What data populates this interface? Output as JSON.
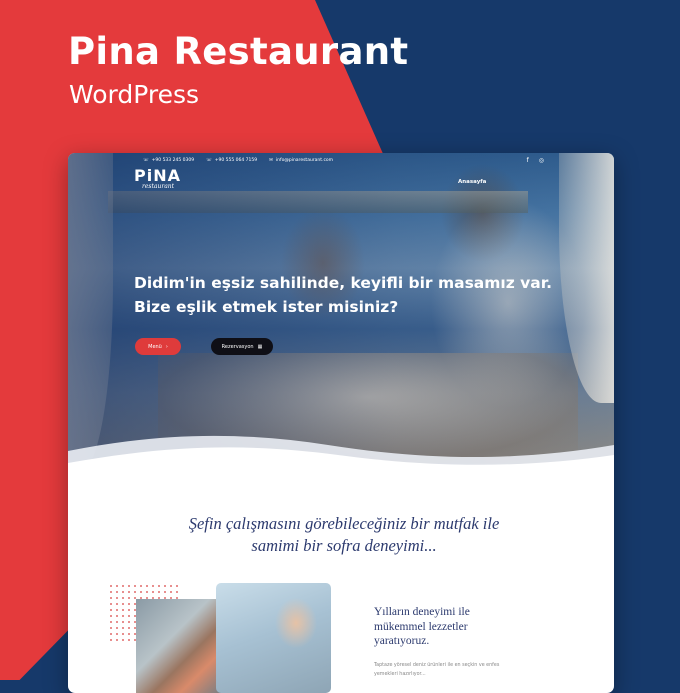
{
  "banner": {
    "title": "Pina Restaurant",
    "subtitle": "WordPress",
    "colors": {
      "red": "#e43a3c",
      "navy": "#16396a"
    }
  },
  "site": {
    "topbar": {
      "phone1": "+90 533 245 0309",
      "phone2": "+90 555 064 7159",
      "email": "info@pinarestaurant.com",
      "social_icons": [
        "facebook-icon",
        "instagram-icon"
      ]
    },
    "logo": {
      "main": "PiNA",
      "sub": "restaurant"
    },
    "nav": {
      "home": "Anasayfa"
    },
    "hero": {
      "headline_line1": "Didim'in eşsiz sahilinde, keyifli bir masamız var.",
      "headline_line2": "Bize eşlik etmek ister misiniz?",
      "menu_button": "Menü",
      "reservation_button": "Rezervasyon"
    },
    "intro": {
      "tagline_line1": "Şefin çalışmasını görebileceğiniz bir mutfak ile",
      "tagline_line2": "samimi bir sofra deneyimi..."
    },
    "about": {
      "heading_line1": "Yılların deneyimi ile",
      "heading_line2": "mükemmel lezzetler",
      "heading_line3": "yaratıyoruz.",
      "text_line1": "Taptaze yöresel deniz ürünleri ile en seçkin ve enfes",
      "text_line2": "yemekleri hazırlıyor..."
    }
  }
}
